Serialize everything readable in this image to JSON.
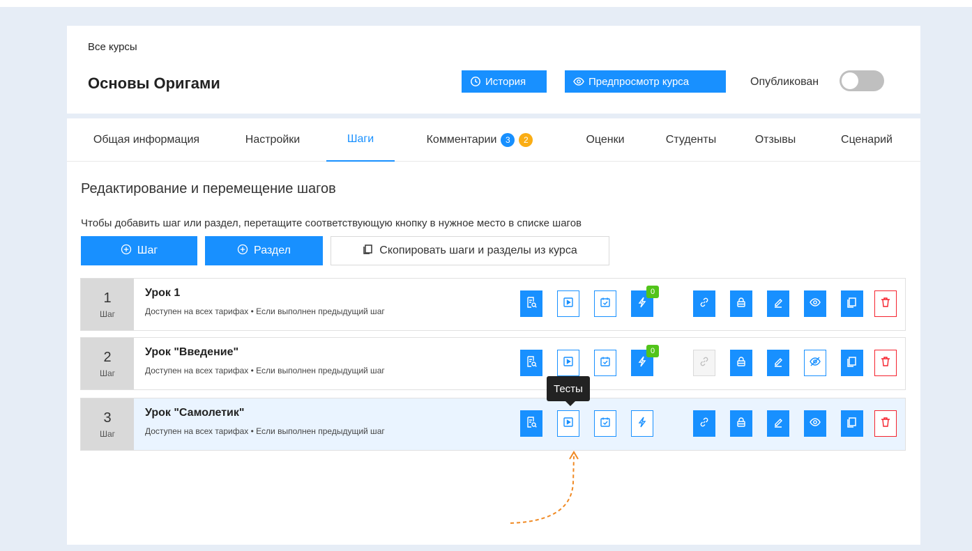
{
  "header": {
    "breadcrumb": "Все курсы",
    "title": "Основы Оригами",
    "history_label": "История",
    "preview_label": "Предпросмотр курса",
    "published_label": "Опубликован",
    "published": false
  },
  "tabs": [
    {
      "label": "Общая информация"
    },
    {
      "label": "Настройки"
    },
    {
      "label": "Шаги",
      "active": true
    },
    {
      "label": "Комментарии",
      "badges": [
        "3",
        "2"
      ]
    },
    {
      "label": "Оценки"
    },
    {
      "label": "Студенты"
    },
    {
      "label": "Отзывы"
    },
    {
      "label": "Сценарий"
    }
  ],
  "steps_section": {
    "title": "Редактирование и перемещение шагов",
    "hint": "Чтобы добавить шаг или раздел, перетащите соответствующую кнопку в нужное место в списке шагов",
    "add_step_label": "Шаг",
    "add_section_label": "Раздел",
    "copy_label": "Скопировать шаги и разделы из курса"
  },
  "steps": [
    {
      "number": "1",
      "unit": "Шаг",
      "title": "Урок 1",
      "access": "Доступен на всех тарифах",
      "condition": "Если выполнен предыдущий шаг",
      "trigger_count": "0"
    },
    {
      "number": "2",
      "unit": "Шаг",
      "title": "Урок \"Введение\"",
      "access": "Доступен на всех тарифах",
      "condition": "Если выполнен предыдущий шаг",
      "trigger_count": "0"
    },
    {
      "number": "3",
      "unit": "Шаг",
      "title": "Урок \"Самолетик\"",
      "access": "Доступен на всех тарифах",
      "condition": "Если выполнен предыдущий шаг",
      "trigger_count": null
    }
  ],
  "tooltip": "Тесты",
  "colors": {
    "primary": "#1890ff",
    "badge_blue": "#1890ff",
    "badge_orange": "#faad14",
    "badge_green": "#52c41a",
    "danger": "#f5222d",
    "annotation_arrow": "#f08a24"
  }
}
